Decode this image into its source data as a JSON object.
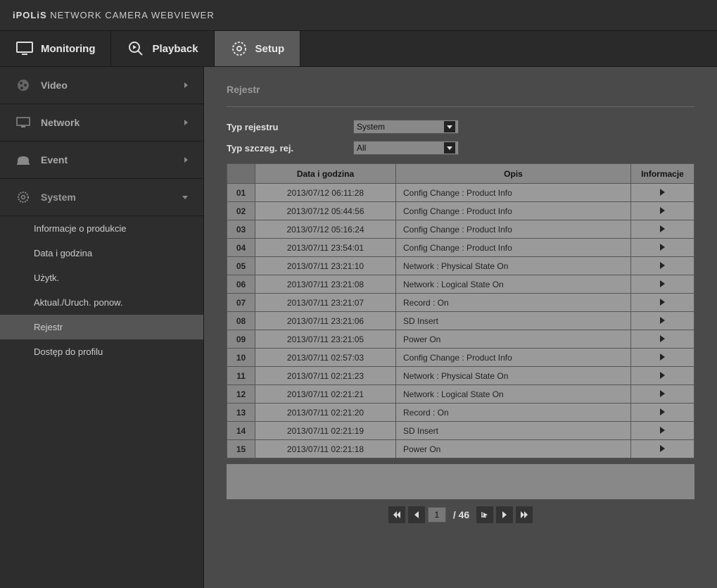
{
  "header": {
    "brand": "iPOLiS",
    "title": "NETWORK CAMERA WEBVIEWER"
  },
  "tabs": {
    "monitoring": "Monitoring",
    "playback": "Playback",
    "setup": "Setup"
  },
  "sidebar": {
    "sections": [
      {
        "label": "Video"
      },
      {
        "label": "Network"
      },
      {
        "label": "Event"
      },
      {
        "label": "System",
        "expanded": true
      }
    ],
    "sub": [
      "Informacje o produkcie",
      "Data i godzina",
      "Użytk.",
      "Aktual./Uruch. ponow.",
      "Rejestr",
      "Dostęp do profilu"
    ]
  },
  "page": {
    "title": "Rejestr",
    "filter1_label": "Typ rejestru",
    "filter1_value": "System",
    "filter2_label": "Typ szczeg. rej.",
    "filter2_value": "All"
  },
  "table": {
    "headers": {
      "datetime": "Data i godzina",
      "desc": "Opis",
      "info": "Informacje"
    },
    "rows": [
      {
        "no": "01",
        "dt": "2013/07/12   06:11:28",
        "desc": "Config Change : Product Info"
      },
      {
        "no": "02",
        "dt": "2013/07/12   05:44:56",
        "desc": "Config Change : Product Info"
      },
      {
        "no": "03",
        "dt": "2013/07/12   05:16:24",
        "desc": "Config Change : Product Info"
      },
      {
        "no": "04",
        "dt": "2013/07/11   23:54:01",
        "desc": "Config Change : Product Info"
      },
      {
        "no": "05",
        "dt": "2013/07/11   23:21:10",
        "desc": "Network : Physical State On"
      },
      {
        "no": "06",
        "dt": "2013/07/11   23:21:08",
        "desc": "Network : Logical State On"
      },
      {
        "no": "07",
        "dt": "2013/07/11   23:21:07",
        "desc": "Record : On"
      },
      {
        "no": "08",
        "dt": "2013/07/11   23:21:06",
        "desc": "SD Insert"
      },
      {
        "no": "09",
        "dt": "2013/07/11   23:21:05",
        "desc": "Power On"
      },
      {
        "no": "10",
        "dt": "2013/07/11   02:57:03",
        "desc": "Config Change : Product Info"
      },
      {
        "no": "11",
        "dt": "2013/07/11   02:21:23",
        "desc": "Network : Physical State On"
      },
      {
        "no": "12",
        "dt": "2013/07/11   02:21:21",
        "desc": "Network : Logical State On"
      },
      {
        "no": "13",
        "dt": "2013/07/11   02:21:20",
        "desc": "Record : On"
      },
      {
        "no": "14",
        "dt": "2013/07/11   02:21:19",
        "desc": "SD Insert"
      },
      {
        "no": "15",
        "dt": "2013/07/11   02:21:18",
        "desc": "Power On"
      }
    ]
  },
  "pager": {
    "current": "1",
    "total": "46"
  }
}
